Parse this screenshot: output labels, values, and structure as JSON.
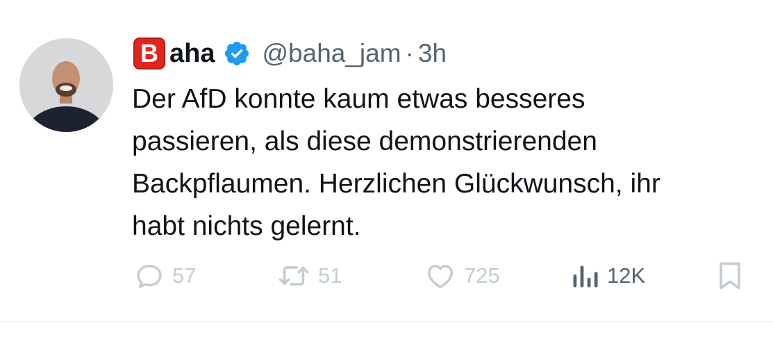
{
  "author": {
    "badge_letter": "B",
    "display_name": "aha",
    "handle": "@baha_jam",
    "separator": "·",
    "time": "3h",
    "verified": true,
    "verified_color": "#1d9bf0"
  },
  "tweet": {
    "lines": [
      "Der AfD konnte kaum etwas besseres",
      "passieren, als diese demonstrierenden",
      "Backpflaumen. Herzlichen Glückwunsch, ihr",
      "habt nichts gelernt."
    ]
  },
  "actions": {
    "reply": {
      "icon": "reply-icon",
      "count": "57"
    },
    "retweet": {
      "icon": "retweet-icon",
      "count": "51"
    },
    "like": {
      "icon": "heart-icon",
      "count": "725"
    },
    "views": {
      "icon": "analytics-icon",
      "count": "12K"
    },
    "bookmark": {
      "icon": "bookmark-icon"
    }
  },
  "colors": {
    "badge_red": "#e0251f",
    "text_primary": "#0f1419",
    "text_secondary": "#536471",
    "icon_faded": "#c3cdd4"
  }
}
